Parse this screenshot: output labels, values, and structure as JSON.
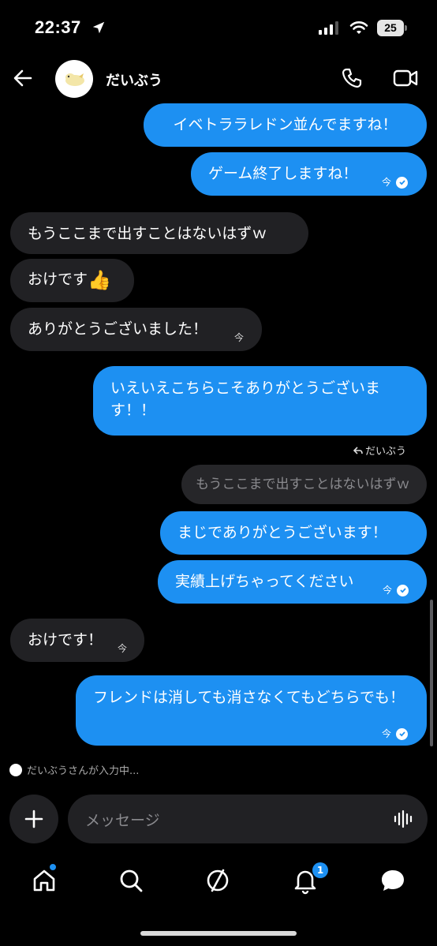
{
  "status_bar": {
    "time": "22:37",
    "battery": "25"
  },
  "header": {
    "contact_name": "だいぶう"
  },
  "messages": [
    {
      "text": "イベトララレドン並んでますね！"
    },
    {
      "text": "ゲーム終了しますね！",
      "time": "今"
    },
    {
      "text": "もうここまで出すことはないはずｗ"
    },
    {
      "text": "おけです",
      "emoji": "👍"
    },
    {
      "text": "ありがとうございました！",
      "time": "今"
    },
    {
      "text": "いえいえこちらこそありがとうございます！！"
    },
    {
      "reply_to": "だいぶう",
      "quoted": "もうここまで出すことはないはずｗ"
    },
    {
      "text": "まじでありがとうございます！"
    },
    {
      "text": "実績上げちゃってください",
      "time": "今"
    },
    {
      "text": "おけです！",
      "time": "今"
    },
    {
      "text": "フレンドは消しても消さなくてもどちらでも！",
      "time": "今"
    }
  ],
  "typing_indicator": "だいぶうさんが入力中...",
  "composer": {
    "placeholder": "メッセージ"
  },
  "tabbar": {
    "notifications_badge": "1"
  },
  "colors": {
    "accent": "#1d90f2",
    "incoming_bubble": "#212124",
    "background": "#000000"
  }
}
